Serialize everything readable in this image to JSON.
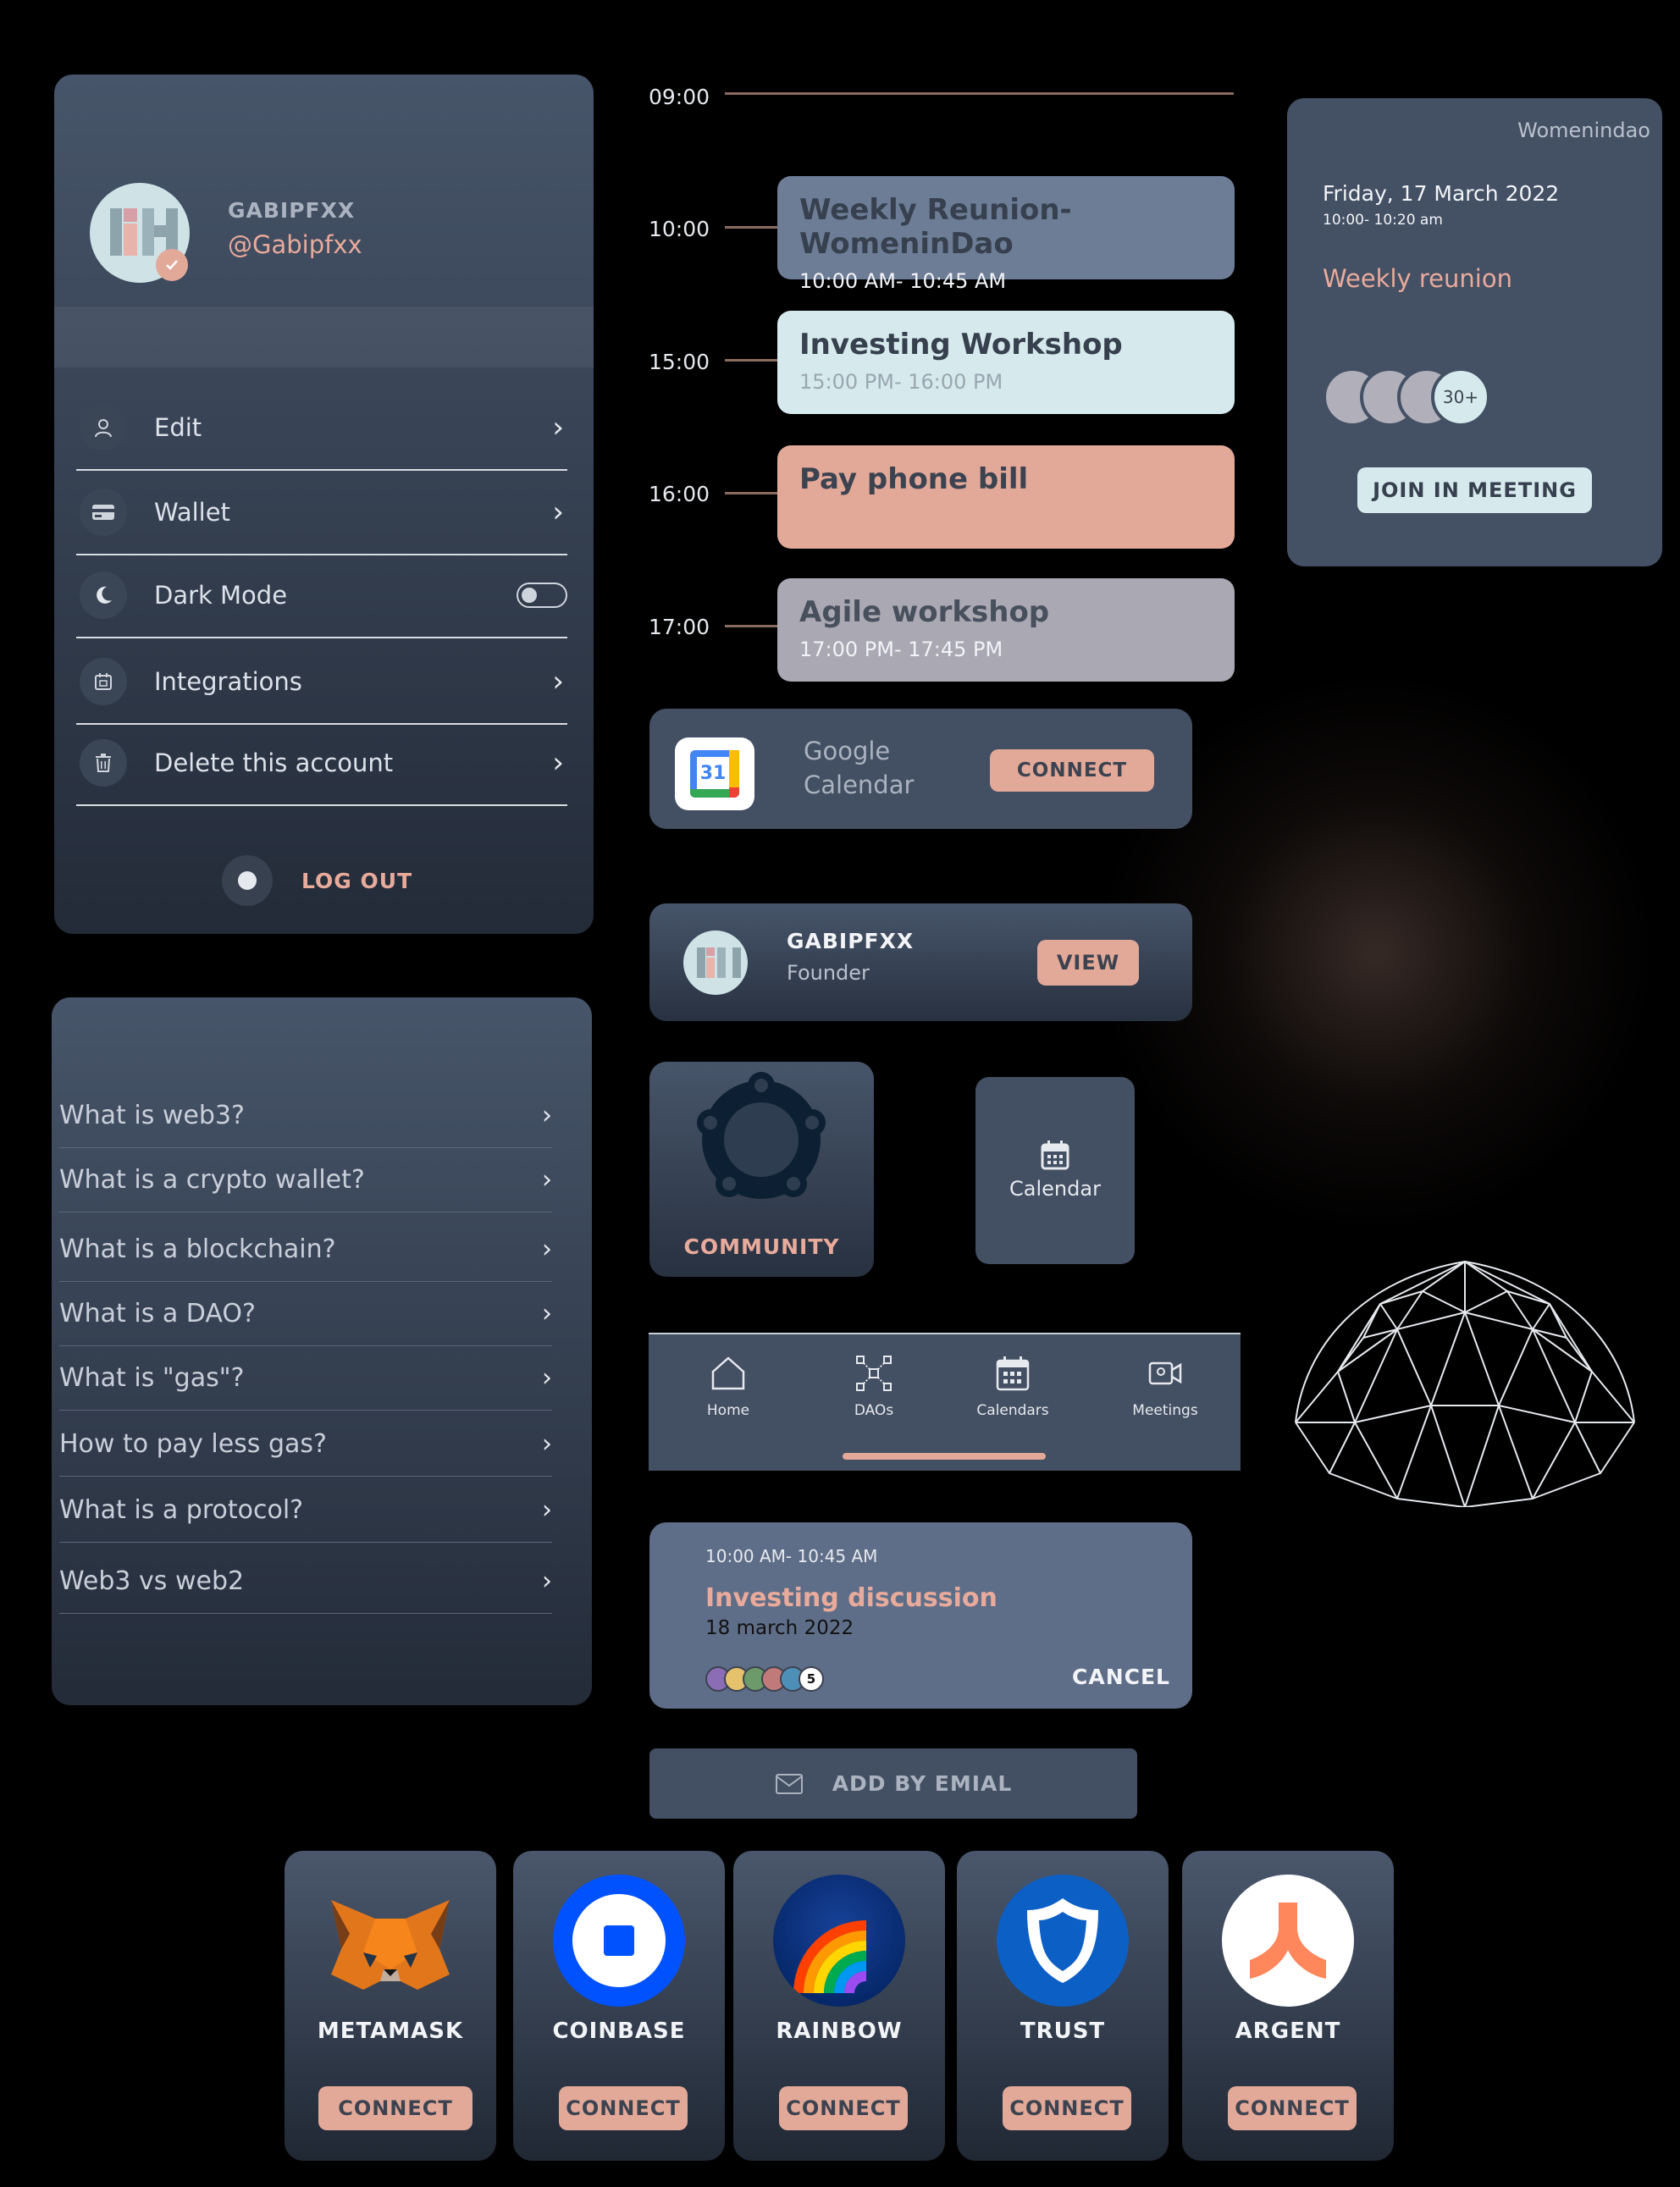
{
  "profile": {
    "display_name": "GABIPFXX",
    "handle": "@Gabipfxx",
    "menu": [
      {
        "label": "Edit",
        "icon": "user-icon"
      },
      {
        "label": "Wallet",
        "icon": "card-icon"
      },
      {
        "label": "Dark Mode",
        "icon": "moon-icon"
      },
      {
        "label": "Integrations",
        "icon": "calendar-small-icon"
      },
      {
        "label": "Delete this account",
        "icon": "trash-icon"
      }
    ],
    "logout_label": "LOG OUT"
  },
  "faq": {
    "items": [
      "What is web3?",
      "What is a crypto wallet?",
      "What is a blockchain?",
      "What is a DAO?",
      "What is \"gas\"?",
      "How to pay less gas?",
      "What is a protocol?",
      "Web3 vs web2"
    ]
  },
  "timeline": {
    "times": [
      "09:00",
      "10:00",
      "15:00",
      "16:00",
      "17:00"
    ],
    "events": [
      {
        "title": "Weekly Reunion-WomeninDao",
        "time": "10:00 AM- 10:45 AM"
      },
      {
        "title": "Investing Workshop",
        "time": "15:00 PM- 16:00 PM"
      },
      {
        "title": "Pay phone bill",
        "time": ""
      },
      {
        "title": "Agile workshop",
        "time": "17:00 PM- 17:45 PM"
      }
    ]
  },
  "meeting_card": {
    "org": "Womenindao",
    "date": "Friday, 17 March 2022",
    "time": "10:00- 10:20 am",
    "title": "Weekly reunion",
    "attendees_more": "30+",
    "join_label": "JOIN IN MEETING"
  },
  "gcal": {
    "icon_number": "31",
    "label": "Google Calendar",
    "connect_label": "CONNECT"
  },
  "member_card": {
    "name": "GABIPFXX",
    "role": "Founder",
    "view_label": "VIEW"
  },
  "community_tile": {
    "label": "COMMUNITY"
  },
  "calendar_tile": {
    "label": "Calendar"
  },
  "bottom_nav": {
    "items": [
      "Home",
      "DAOs",
      "Calendars",
      "Meetings"
    ]
  },
  "discussion": {
    "time": "10:00 AM- 10:45 AM",
    "title": "Investing discussion",
    "date": "18 march 2022",
    "extra_count": "5",
    "cancel_label": "CANCEL"
  },
  "add_email": {
    "label": "ADD BY EMIAL"
  },
  "wallets": [
    {
      "name": "METAMASK",
      "connect": "CONNECT"
    },
    {
      "name": "COINBASE",
      "connect": "CONNECT"
    },
    {
      "name": "RAINBOW",
      "connect": "CONNECT"
    },
    {
      "name": "TRUST",
      "connect": "CONNECT"
    },
    {
      "name": "ARGENT",
      "connect": "CONNECT"
    }
  ],
  "colors": {
    "accent": "#e2a898",
    "panel_top": "#47556a",
    "panel_bottom": "#232b38",
    "event_blue": "#6e7d96",
    "event_mint": "#d6e9ec",
    "event_salmon": "#e2a898",
    "event_gray": "#a9a8b3"
  }
}
